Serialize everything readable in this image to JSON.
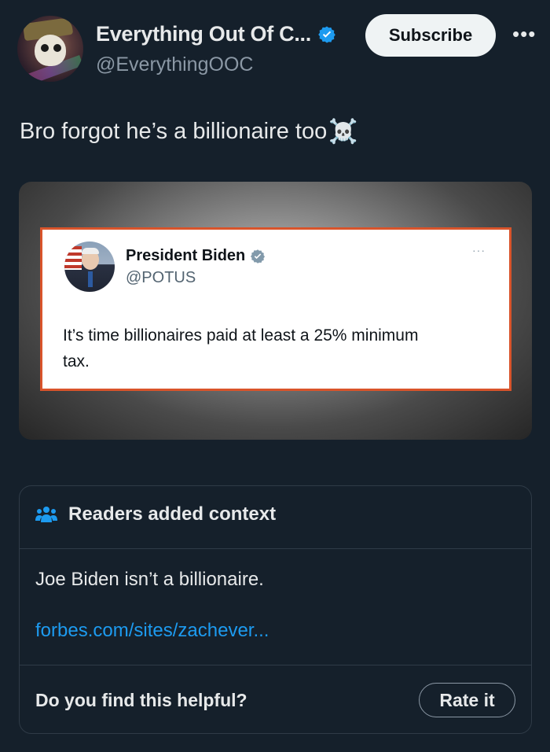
{
  "post": {
    "author": {
      "display_name": "Everything Out Of C...",
      "handle": "@EverythingOOC",
      "verified": true,
      "avatar_icon": "skull-avatar"
    },
    "subscribe_label": "Subscribe",
    "more_icon": "more-horizontal-icon",
    "text": "Bro forgot he’s a billionaire too",
    "text_emoji": "☠️"
  },
  "embedded_tweet": {
    "display_name": "President Biden",
    "handle": "@POTUS",
    "verified": true,
    "text": "It’s time billionaires paid at least a 25% minimum tax.",
    "more_icon": "···"
  },
  "community_note": {
    "title": "Readers added context",
    "icon": "people-icon",
    "body": "Joe Biden isn’t a billionaire.",
    "link": "forbes.com/sites/zachever...",
    "helpful_prompt": "Do you find this helpful?",
    "rate_label": "Rate it"
  },
  "colors": {
    "background": "#15202b",
    "text_primary": "#e7e9ea",
    "text_secondary": "#8b98a5",
    "link": "#1d9bf0",
    "verified": "#1d9bf0",
    "embed_border": "#d9542b"
  }
}
